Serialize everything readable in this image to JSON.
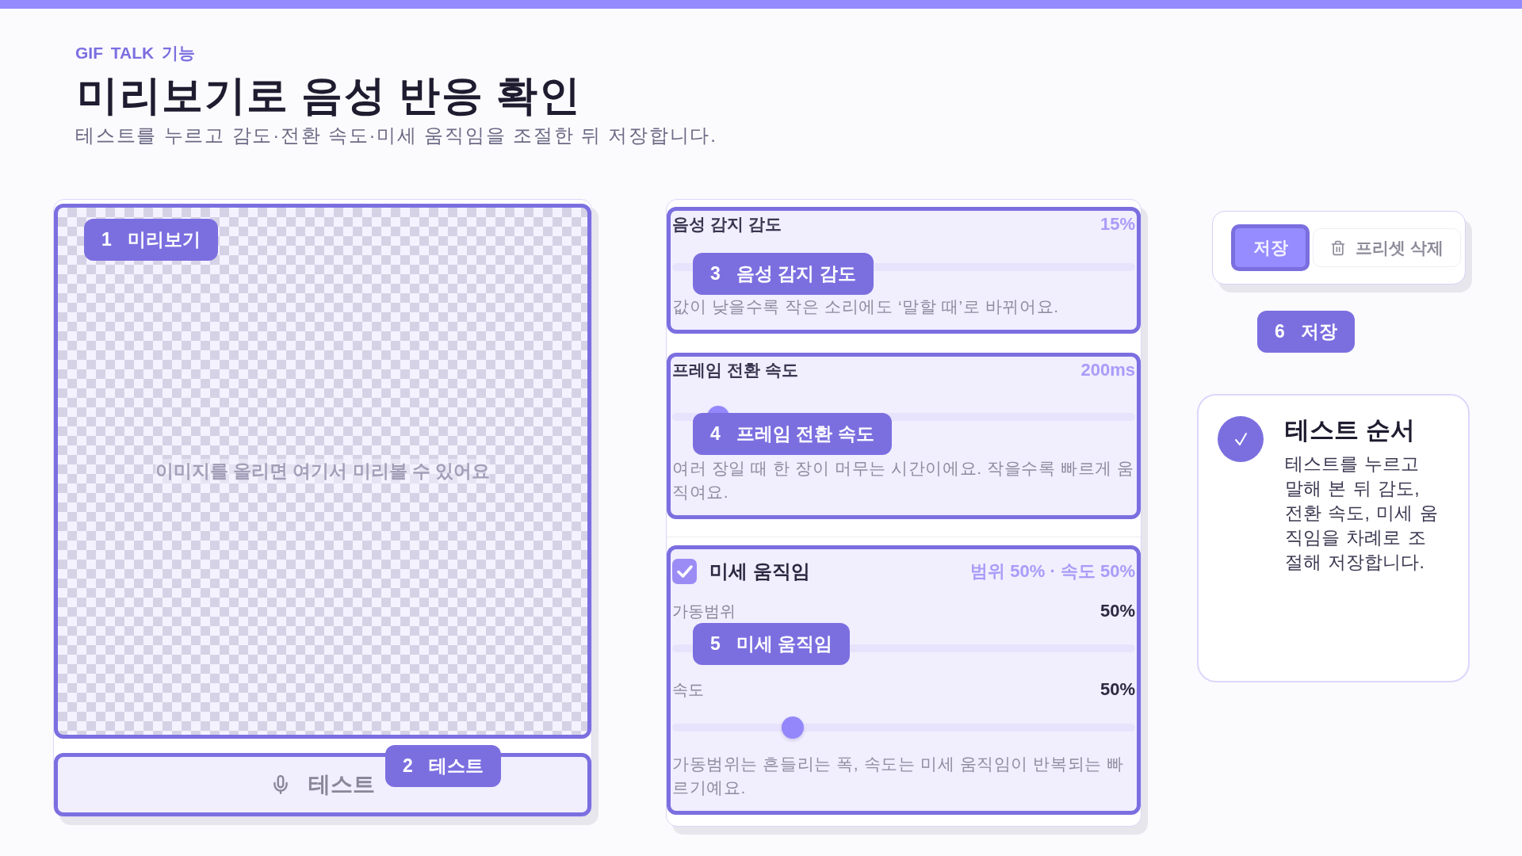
{
  "header": {
    "eyebrow": "GIF TALK 기능",
    "title": "미리보기로 음성 반응 확인",
    "subtitle": "테스트를 누르고 감도·전환 속도·미세 움직임을 조절한 뒤 저장합니다."
  },
  "preview": {
    "highlighted": true,
    "placeholder": "이미지를 올리면 여기서 미리볼 수 있어요",
    "callout": {
      "number": "1",
      "label": "미리보기"
    }
  },
  "test_button": {
    "label": "테스트",
    "highlighted": true,
    "callout": {
      "number": "2",
      "label": "테스트"
    }
  },
  "settings": [
    {
      "kind": "slider",
      "highlighted": true,
      "label": "음성 감지 감도",
      "reading": "15%",
      "description": "값이 낮을수록 작은 소리에도 ‘말할 때’로 바뀌어요.",
      "callout": {
        "number": "3",
        "label": "음성 감지 감도"
      }
    },
    {
      "kind": "slider",
      "highlighted": true,
      "label": "프레임 전환 속도",
      "reading": "200ms",
      "level": 0.1,
      "description": "여러 장일 때 한 장이 머무는 시간이에요. 작을수록 빠르게 움직여요.",
      "callout": {
        "number": "4",
        "label": "프레임 전환 속도"
      }
    },
    {
      "kind": "toggle_group",
      "highlighted": true,
      "checked": true,
      "label": "미세 움직임",
      "reading": "범위 50% · 속도 50%",
      "sliders": [
        {
          "label": "가동범위",
          "reading": "50%"
        },
        {
          "label": "속도",
          "reading": "50%",
          "level": 0.26
        }
      ],
      "description": "가동범위는 흔들리는 폭, 속도는 미세 움직임이 반복되는 빠르기예요.",
      "callout": {
        "number": "5",
        "label": "미세 움직임"
      }
    }
  ],
  "actions": {
    "buttons": [
      {
        "kind": "primary",
        "label": "저장",
        "highlighted": true
      },
      {
        "kind": "delete",
        "label": "프리셋 삭제",
        "highlighted": false
      }
    ],
    "callout": {
      "number": "6",
      "label": "저장"
    }
  },
  "tip": {
    "title": "테스트 순서",
    "body": "테스트를 누르고 말해 본 뒤 감도, 전환 속도, 미세 움직임을 차례로 조절해 저장합니다."
  }
}
